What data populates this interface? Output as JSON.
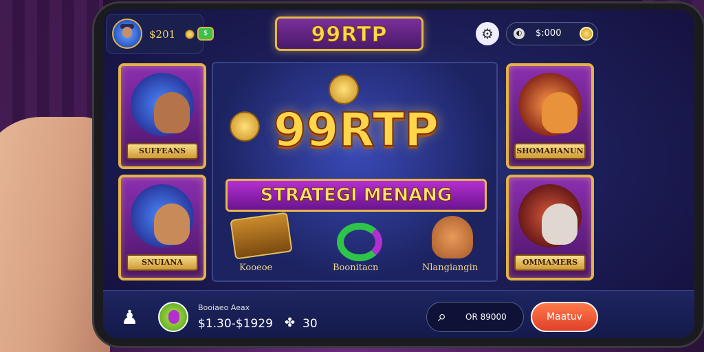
{
  "header": {
    "balance": "$201",
    "cash_icon_label": "$",
    "logo": "99RTP",
    "currency_value": "$:000"
  },
  "banner": {
    "title": "99RTP",
    "subtitle": "STRATEGI MENANG"
  },
  "cards": [
    {
      "label": "SUFFEANS"
    },
    {
      "label": "SNUIANA"
    },
    {
      "label": "SHOMAHANUN"
    },
    {
      "label": "OMMAMERS"
    }
  ],
  "center_items": [
    {
      "label": "Kooeoe"
    },
    {
      "label": "Boonitacn"
    },
    {
      "label": "Nlangiangin"
    }
  ],
  "footer": {
    "game_name": "Booiaeo Aeax",
    "game_range": "$1.30-$1929",
    "chips_count": "30",
    "search_text": "OR 89000",
    "action_label": "Maatuv"
  }
}
